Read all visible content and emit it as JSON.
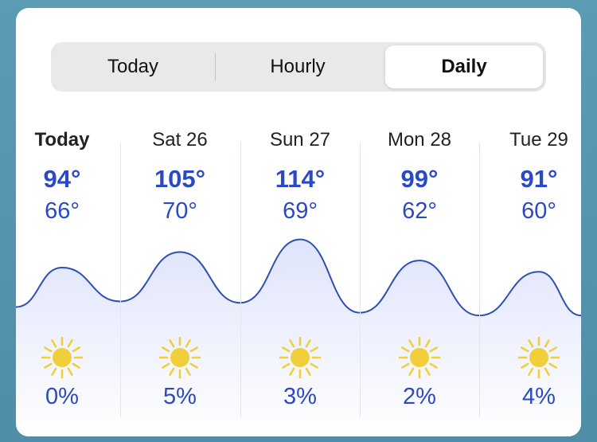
{
  "tabs": [
    "Today",
    "Hourly",
    "Daily"
  ],
  "selected_tab": "Daily",
  "days": [
    {
      "label": "Today",
      "high": "94°",
      "low": "66°",
      "icon": "sun-icon",
      "precip": "0%"
    },
    {
      "label": "Sat 26",
      "high": "105°",
      "low": "70°",
      "icon": "sun-icon",
      "precip": "5%"
    },
    {
      "label": "Sun 27",
      "high": "114°",
      "low": "69°",
      "icon": "sun-icon",
      "precip": "3%"
    },
    {
      "label": "Mon 28",
      "high": "99°",
      "low": "62°",
      "icon": "sun-icon",
      "precip": "2%"
    },
    {
      "label": "Tue 29",
      "high": "91°",
      "low": "60°",
      "icon": "sun-icon",
      "precip": "4%"
    }
  ],
  "colors": {
    "temperature_text": "#2b49c4",
    "curve": "#2f4fb5",
    "sun": "#f1cf3a"
  }
}
